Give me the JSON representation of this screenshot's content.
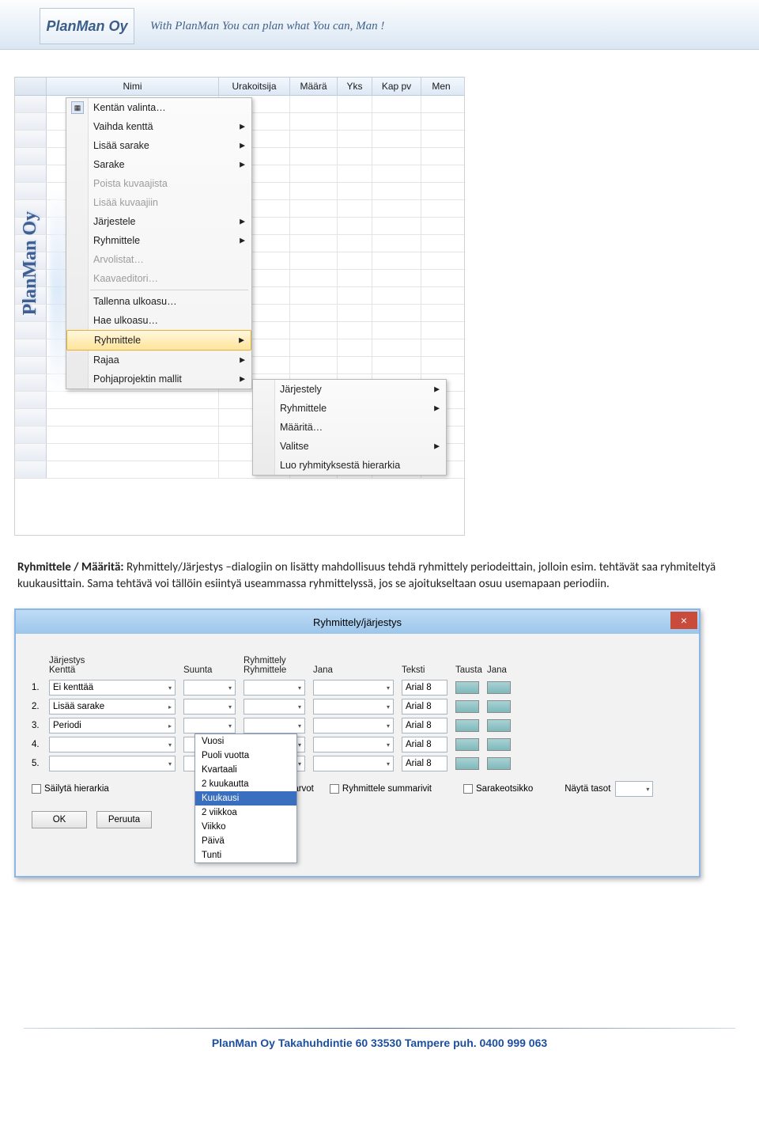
{
  "header": {
    "logo_text": "PlanMan Oy",
    "tagline": "With PlanMan You can plan what You can, Man !"
  },
  "screenshot1": {
    "columns": [
      "",
      "Nimi",
      "Urakoitsija",
      "Määrä",
      "Yks",
      "Kap pv",
      "Men"
    ],
    "vertical_label": "PlanMan Oy",
    "menu1": [
      {
        "label": "Kentän valinta…",
        "icon": true
      },
      {
        "label": "Vaihda kenttä",
        "sub": true
      },
      {
        "label": "Lisää sarake",
        "sub": true
      },
      {
        "label": "Sarake",
        "sub": true
      },
      {
        "label": "Poista kuvaajista",
        "disabled": true
      },
      {
        "label": "Lisää kuvaajiin",
        "disabled": true
      },
      {
        "label": "Järjestele",
        "sub": true
      },
      {
        "label": "Ryhmittele",
        "sub": true
      },
      {
        "label": "Arvolistat…",
        "disabled": true
      },
      {
        "label": "Kaavaeditori…",
        "disabled": true
      },
      {
        "sep": true
      },
      {
        "label": "Tallenna ulkoasu…"
      },
      {
        "label": "Hae ulkoasu…"
      },
      {
        "label": "Ryhmittele",
        "sub": true,
        "highlight": true
      },
      {
        "label": "Rajaa",
        "sub": true
      },
      {
        "label": "Pohjaprojektin mallit",
        "sub": true
      }
    ],
    "menu2": [
      {
        "label": "Järjestely",
        "sub": true
      },
      {
        "label": "Ryhmittele",
        "sub": true
      },
      {
        "label": "Määritä…"
      },
      {
        "label": "Valitse",
        "sub": true
      },
      {
        "label": "Luo ryhmityksestä hierarkia"
      }
    ]
  },
  "paragraph": {
    "heading": "Ryhmittele / Määritä:",
    "text": " Ryhmittely/Järjestys –dialogiin on lisätty mahdollisuus tehdä ryhmittely periodeittain, jolloin esim. tehtävät saa ryhmiteltyä kuukausittain. Sama tehtävä voi tällöin esiintyä useammassa ryhmittelyssä, jos se ajoitukseltaan osuu usemapaan periodiin."
  },
  "dialog": {
    "title": "Ryhmittely/järjestys",
    "group_headings": {
      "jar": "Järjestys",
      "ryh": "Ryhmittely"
    },
    "cols": {
      "kentta": "Kenttä",
      "suunta": "Suunta",
      "ryhm": "Ryhmittele",
      "jana": "Jana",
      "teksti": "Teksti",
      "tausta": "Tausta",
      "jana2": "Jana"
    },
    "rows": [
      {
        "n": "1.",
        "field": "Ei kenttää",
        "arrow": false,
        "text": "Arial 8"
      },
      {
        "n": "2.",
        "field": "Lisää sarake",
        "arrow": true,
        "text": "Arial 8"
      },
      {
        "n": "3.",
        "field": "Periodi",
        "arrow": true,
        "text": "Arial 8"
      },
      {
        "n": "4.",
        "field": "",
        "arrow": false,
        "text": "Arial 8"
      },
      {
        "n": "5.",
        "field": "",
        "arrow": false,
        "text": "Arial 8"
      }
    ],
    "period_options": [
      "Vuosi",
      "Puoli vuotta",
      "Kvartaali",
      "2 kuukautta",
      "Kuukausi",
      "2 viikkoa",
      "Viikko",
      "Päivä",
      "Tunti"
    ],
    "period_highlight": "Kuukausi",
    "checks": {
      "sailyta": "Säilytä hierarkia",
      "tyhjat": "yhjät arvot",
      "summarivit": "Ryhmittele summarivit",
      "sarakeotsikko": "Sarakeotsikko"
    },
    "nayta_tasot": "Näytä tasot",
    "ok": "OK",
    "peruuta": "Peruuta"
  },
  "footer": {
    "text": "PlanMan Oy   Takahuhdintie 60   33530 Tampere   puh. 0400 999 063"
  }
}
